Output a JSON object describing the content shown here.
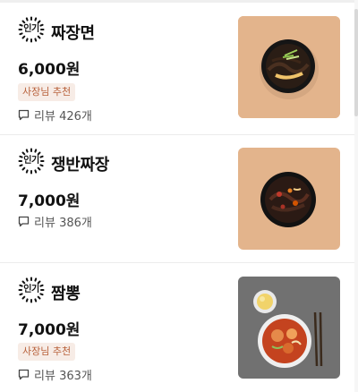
{
  "menu": [
    {
      "badge": "인기",
      "name": "짜장면",
      "price": "6,000원",
      "tag": "사장님 추천",
      "review_label": "리뷰",
      "review_count": "426개",
      "photo": "jjajangmyeon-photo"
    },
    {
      "badge": "인기",
      "name": "쟁반짜장",
      "price": "7,000원",
      "tag": null,
      "review_label": "리뷰",
      "review_count": "386개",
      "photo": "jaengban-jjajang-photo"
    },
    {
      "badge": "인기",
      "name": "짬뽕",
      "price": "7,000원",
      "tag": "사장님 추천",
      "review_label": "리뷰",
      "review_count": "363개",
      "photo": "jjamppong-photo"
    }
  ],
  "colors": {
    "tag_bg": "#f7ece6",
    "tag_text": "#b8603a",
    "divider": "#ececec",
    "plate_bg_warm": "#e3b48c",
    "plate_bg_gray": "#7b7b7b"
  }
}
